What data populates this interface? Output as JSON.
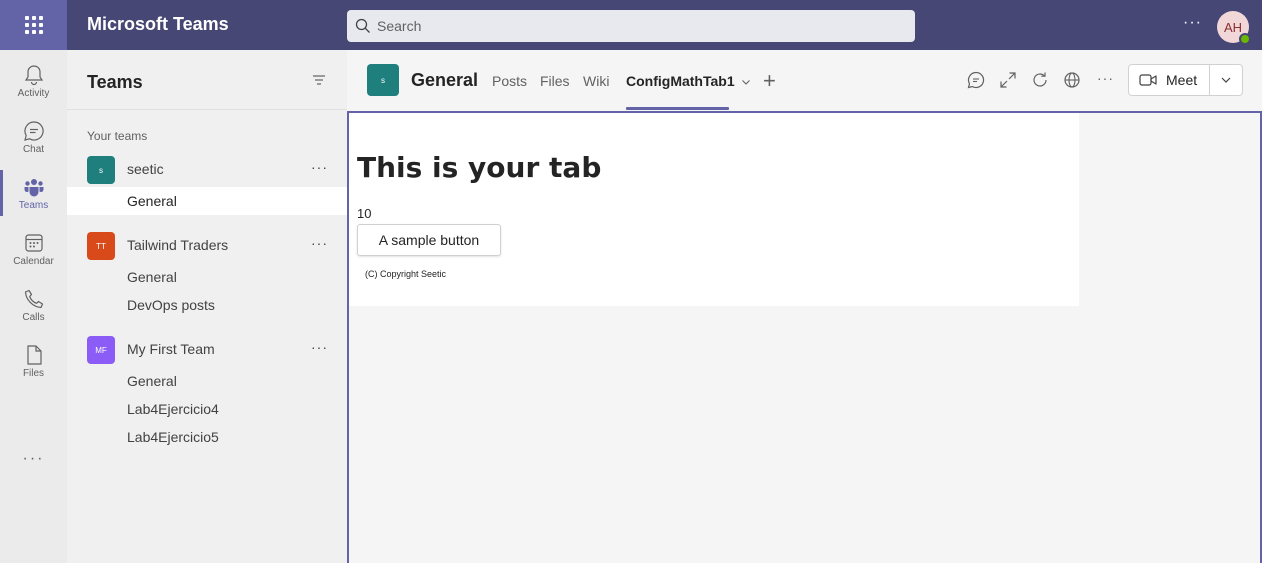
{
  "app": {
    "title": "Microsoft Teams"
  },
  "search": {
    "placeholder": "Search"
  },
  "topbar": {
    "more": "···",
    "avatar_initials": "AH"
  },
  "rail": {
    "items": [
      {
        "label": "Activity",
        "icon": "bell-icon"
      },
      {
        "label": "Chat",
        "icon": "chat-icon"
      },
      {
        "label": "Teams",
        "icon": "teams-icon"
      },
      {
        "label": "Calendar",
        "icon": "calendar-icon"
      },
      {
        "label": "Calls",
        "icon": "phone-icon"
      },
      {
        "label": "Files",
        "icon": "file-icon"
      }
    ],
    "more": "···"
  },
  "teams_panel": {
    "title": "Teams",
    "section_label": "Your teams",
    "teams": [
      {
        "name": "seetic",
        "avatar": "s",
        "color": "#1f7f7d",
        "channels": [
          "General"
        ]
      },
      {
        "name": "Tailwind Traders",
        "avatar": "TT",
        "color": "#d94a1b",
        "channels": [
          "General",
          "DevOps posts"
        ]
      },
      {
        "name": "My First Team",
        "avatar": "MF",
        "color": "#8b5cf6",
        "channels": [
          "General",
          "Lab4Ejercicio4",
          "Lab4Ejercicio5"
        ]
      }
    ],
    "more": "···"
  },
  "channel_header": {
    "avatar": "s",
    "name": "General",
    "tabs": [
      "Posts",
      "Files",
      "Wiki",
      "ConfigMathTab1"
    ],
    "add_tab": "+",
    "meet_label": "Meet",
    "more": "···"
  },
  "tab_content": {
    "heading": "This is your tab",
    "value": "10",
    "button_label": "A sample button",
    "copyright": "(C) Copyright Seetic"
  },
  "colors": {
    "accent": "#6264a7",
    "topbar": "#464775"
  }
}
